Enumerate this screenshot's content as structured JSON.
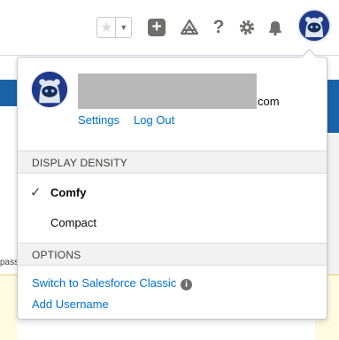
{
  "header": {
    "favorites_star_icon": "star-icon",
    "favorites_menu_icon": "caret-down-icon",
    "global_actions_icon": "plus-icon",
    "trailhead_icon": "trailhead-icon",
    "help_icon": "?",
    "setup_icon": "gear-icon",
    "notifications_icon": "bell-icon",
    "avatar_icon": "astro-avatar-icon"
  },
  "profile": {
    "email_suffix": "com",
    "settings_label": "Settings",
    "logout_label": "Log Out"
  },
  "display_density": {
    "heading": "DISPLAY DENSITY",
    "options": [
      {
        "label": "Comfy",
        "selected": true
      },
      {
        "label": "Compact",
        "selected": false
      }
    ]
  },
  "options": {
    "heading": "OPTIONS",
    "switch_classic_label": "Switch to Salesforce Classic",
    "info_icon": "i",
    "add_username_label": "Add Username"
  },
  "background": {
    "partial_text": "pass"
  },
  "colors": {
    "link": "#0070d2",
    "icon_grey": "#706e6b",
    "section_bg": "#f3f2f2",
    "brand_blue": "#1a62a8"
  }
}
